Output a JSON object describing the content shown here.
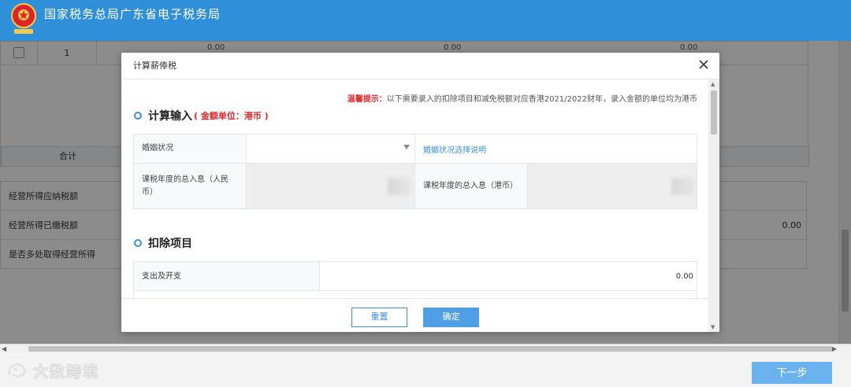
{
  "header": {
    "site_title": "国家税务总局广东省电子税务局",
    "brand_color": "#2f8fd8"
  },
  "background_page": {
    "row_index": "1",
    "row_values": [
      "0.00",
      "0.00",
      "0.00"
    ],
    "total_label": "合计",
    "list": [
      {
        "label": "经营所得应纳税额",
        "value": ""
      },
      {
        "label": "经营所得已缴税额",
        "value": "0.00"
      },
      {
        "label": "是否多处取得经营所得",
        "value": ""
      }
    ]
  },
  "modal": {
    "title": "计算薪俸税",
    "tip_label": "温馨提示：",
    "tip_text": "以下需要录入的扣除项目和减免税额对应香港2021/2022财年，录入金额的单位均为港币",
    "section_input": {
      "title": "计算输入",
      "unit_note": "( 金额单位：港币 )",
      "marital_label": "婚姻状况",
      "marital_value": "",
      "marital_link": "婚姻状况选择说明",
      "income_rmb_label": "课税年度的总入息（人民币）",
      "income_hkd_label": "课税年度的总入息（港币）"
    },
    "section_deduction": {
      "title": "扣除项目",
      "rows": [
        {
          "label": "支出及开支",
          "value": "0.00"
        }
      ]
    },
    "buttons": {
      "reset": "重置",
      "confirm": "确定"
    }
  },
  "footer": {
    "watermark": "大数跨境",
    "next_button": "下一步"
  },
  "colors": {
    "accent": "#3b8ee0",
    "warning": "#e0262b",
    "primary_button": "#4e9fe6"
  }
}
